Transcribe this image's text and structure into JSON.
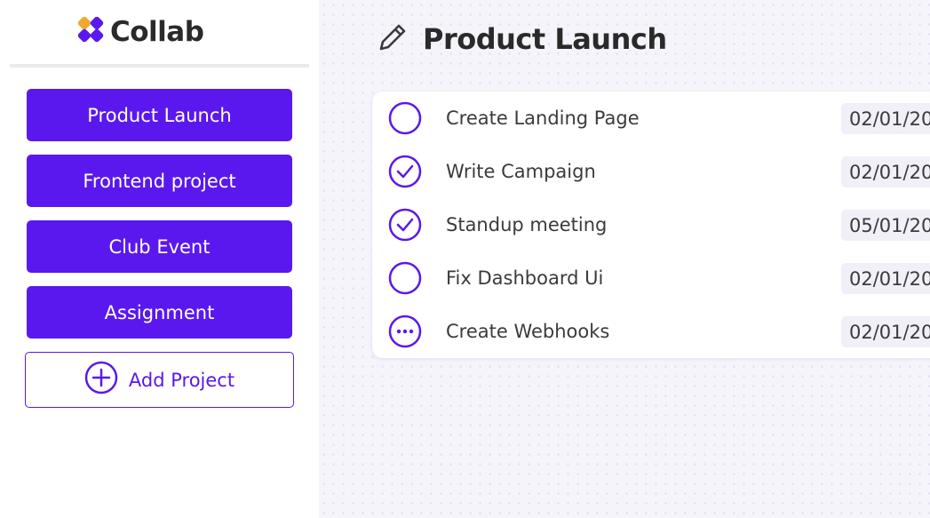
{
  "brand": {
    "name": "Collab",
    "logo_icon": "collab-logo-icon",
    "logo_colors": [
      "#f0a830",
      "#5a18ee"
    ]
  },
  "sidebar": {
    "projects": [
      {
        "label": "Product Launch"
      },
      {
        "label": "Frontend project"
      },
      {
        "label": "Club Event"
      },
      {
        "label": "Assignment"
      }
    ],
    "add_project_label": "Add Project",
    "add_project_icon": "plus-circle-icon"
  },
  "main": {
    "title": "Product Launch",
    "title_icon": "pencil-icon",
    "tasks": [
      {
        "name": "Create Landing Page",
        "date": "02/01/20",
        "status": "todo",
        "icon": "empty-circle-icon"
      },
      {
        "name": "Write Campaign",
        "date": "02/01/20",
        "status": "done",
        "icon": "check-circle-icon"
      },
      {
        "name": "Standup meeting",
        "date": "05/01/20",
        "status": "done",
        "icon": "check-circle-icon"
      },
      {
        "name": "Fix Dashboard Ui",
        "date": "02/01/20",
        "status": "todo",
        "icon": "empty-circle-icon"
      },
      {
        "name": "Create Webhooks",
        "date": "02/01/20",
        "status": "in-progress",
        "icon": "dots-circle-icon"
      }
    ]
  },
  "colors": {
    "accent": "#5a18ee",
    "background": "#f5f4fb",
    "logo_orange": "#f0a830"
  }
}
